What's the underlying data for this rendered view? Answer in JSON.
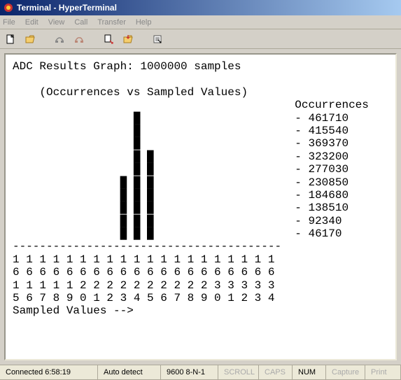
{
  "window": {
    "title": "Terminal - HyperTerminal"
  },
  "menu": {
    "file": "File",
    "edit": "Edit",
    "view": "View",
    "call": "Call",
    "transfer": "Transfer",
    "help": "Help"
  },
  "toolbar": {
    "new": "new",
    "open": "open",
    "connect": "connect",
    "disconnect": "disconnect",
    "send": "send",
    "receive": "receive",
    "properties": "properties"
  },
  "status": {
    "connected": "Connected 6:58:19",
    "detect": "Auto detect",
    "port": "9600 8-N-1",
    "scroll": "SCROLL",
    "caps": "CAPS",
    "num": "NUM",
    "capture": "Capture",
    "print": "Print"
  },
  "chart_data": {
    "type": "bar",
    "title": "ADC Results Graph: 1000000 samples",
    "subtitle": "(Occurrences vs Sampled Values)",
    "xlabel": "Sampled Values -->",
    "ylabel": "Occurrences",
    "legend_label": "Occurrences",
    "yticks": [
      461710,
      415540,
      369370,
      323200,
      277030,
      230850,
      184680,
      138510,
      92340,
      46170
    ],
    "categories": [
      "1615",
      "1616",
      "1617",
      "1618",
      "1619",
      "1620",
      "1621",
      "1622",
      "1623",
      "1624",
      "1625",
      "1626",
      "1627",
      "1628",
      "1629",
      "1630",
      "1631",
      "1632",
      "1633",
      "1634"
    ],
    "heights": [
      0,
      0,
      0,
      0,
      0,
      0,
      0,
      0,
      5,
      10,
      7,
      0,
      0,
      0,
      0,
      0,
      0,
      0,
      0,
      0
    ],
    "values": [
      0,
      0,
      0,
      0,
      0,
      0,
      0,
      0,
      230850,
      461710,
      323200,
      0,
      0,
      0,
      0,
      0,
      0,
      0,
      0,
      0
    ],
    "ylim": [
      0,
      461710
    ]
  }
}
